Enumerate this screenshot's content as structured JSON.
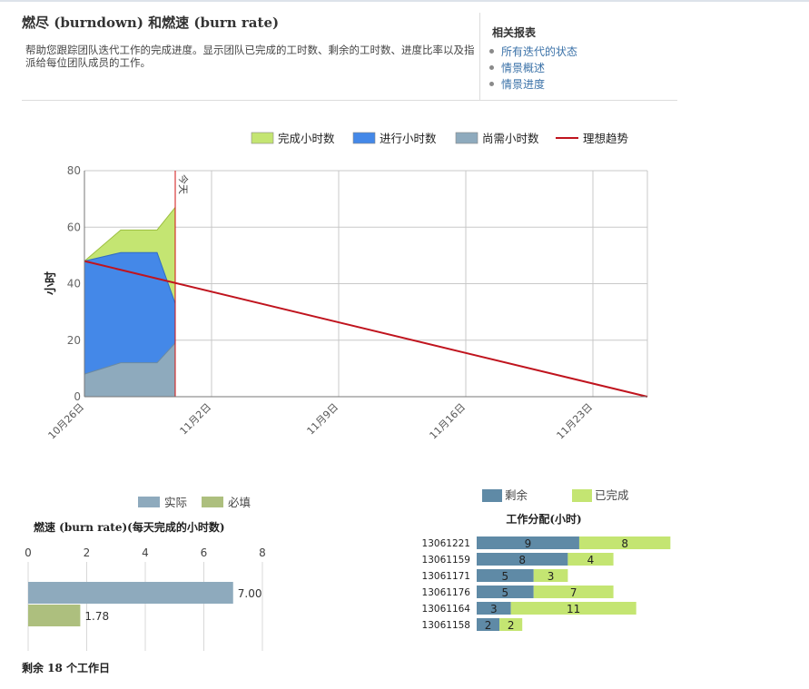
{
  "header": {
    "title": "燃尽 (burndown) 和燃速 (burn rate)",
    "description": "帮助您跟踪团队迭代工作的完成进度。显示团队已完成的工时数、剩余的工时数、进度比率以及指派给每位团队成员的工作。"
  },
  "related_reports": {
    "title": "相关报表",
    "items": [
      {
        "label": "所有迭代的状态"
      },
      {
        "label": "情景概述"
      },
      {
        "label": "情景进度"
      }
    ]
  },
  "footer": {
    "remaining_text": "剩余 18 个工作日"
  },
  "colors": {
    "completed": "#c4e572",
    "in_progress": "#4488e8",
    "remaining": "#8eaabd",
    "ideal": "#c0141e",
    "actual_bar": "#8eaabd",
    "required_bar": "#adbf7e",
    "work_remaining": "#5f8aa6",
    "work_done": "#c4e572"
  },
  "chart_data": [
    {
      "type": "area",
      "title": "",
      "xlabel": "",
      "ylabel": "小时",
      "ylim": [
        0,
        80
      ],
      "grid": true,
      "legend_position": "top",
      "x_start": "2013-10-26",
      "x_end": "2013-11-26",
      "x_tick_labels": [
        "10月26日",
        "11月2日",
        "11月9日",
        "11月16日",
        "11月23日"
      ],
      "x_tick_dates": [
        "2013-10-26",
        "2013-11-02",
        "2013-11-09",
        "2013-11-16",
        "2013-11-23"
      ],
      "y_ticks": [
        0,
        20,
        40,
        60,
        80
      ],
      "x": [
        "2013-10-26",
        "2013-10-28",
        "2013-10-29",
        "2013-10-30",
        "2013-10-31"
      ],
      "series": [
        {
          "name": "尚需小时数",
          "values": [
            8,
            12,
            12,
            12,
            19
          ]
        },
        {
          "name": "进行小时数",
          "values": [
            40,
            39,
            39,
            39,
            14
          ]
        },
        {
          "name": "完成小时数",
          "values": [
            0,
            8,
            8,
            8,
            34
          ]
        }
      ],
      "ideal_trend": {
        "name": "理想趋势",
        "x": [
          "2013-10-26",
          "2013-11-26"
        ],
        "values": [
          48,
          0
        ]
      },
      "today_marker": {
        "label": "今天",
        "date": "2013-10-31"
      }
    },
    {
      "type": "bar",
      "orientation": "horizontal",
      "title": "燃速 (burn rate)(每天完成的小时数)",
      "xlim": [
        0,
        8
      ],
      "x_ticks": [
        0,
        2,
        4,
        6,
        8
      ],
      "legend_position": "top",
      "series": [
        {
          "name": "实际",
          "value": 7.0,
          "label": "7.00"
        },
        {
          "name": "必填",
          "value": 1.78,
          "label": "1.78"
        }
      ]
    },
    {
      "type": "bar",
      "orientation": "horizontal",
      "stacked": true,
      "title": "工作分配(小时)",
      "legend_position": "top",
      "categories": [
        "13061221",
        "13061159",
        "13061171",
        "13061176",
        "13061164",
        "13061158"
      ],
      "series": [
        {
          "name": "剩余",
          "values": [
            9,
            8,
            5,
            5,
            3,
            2
          ]
        },
        {
          "name": "已完成",
          "values": [
            8,
            4,
            3,
            7,
            11,
            2
          ]
        }
      ]
    }
  ]
}
